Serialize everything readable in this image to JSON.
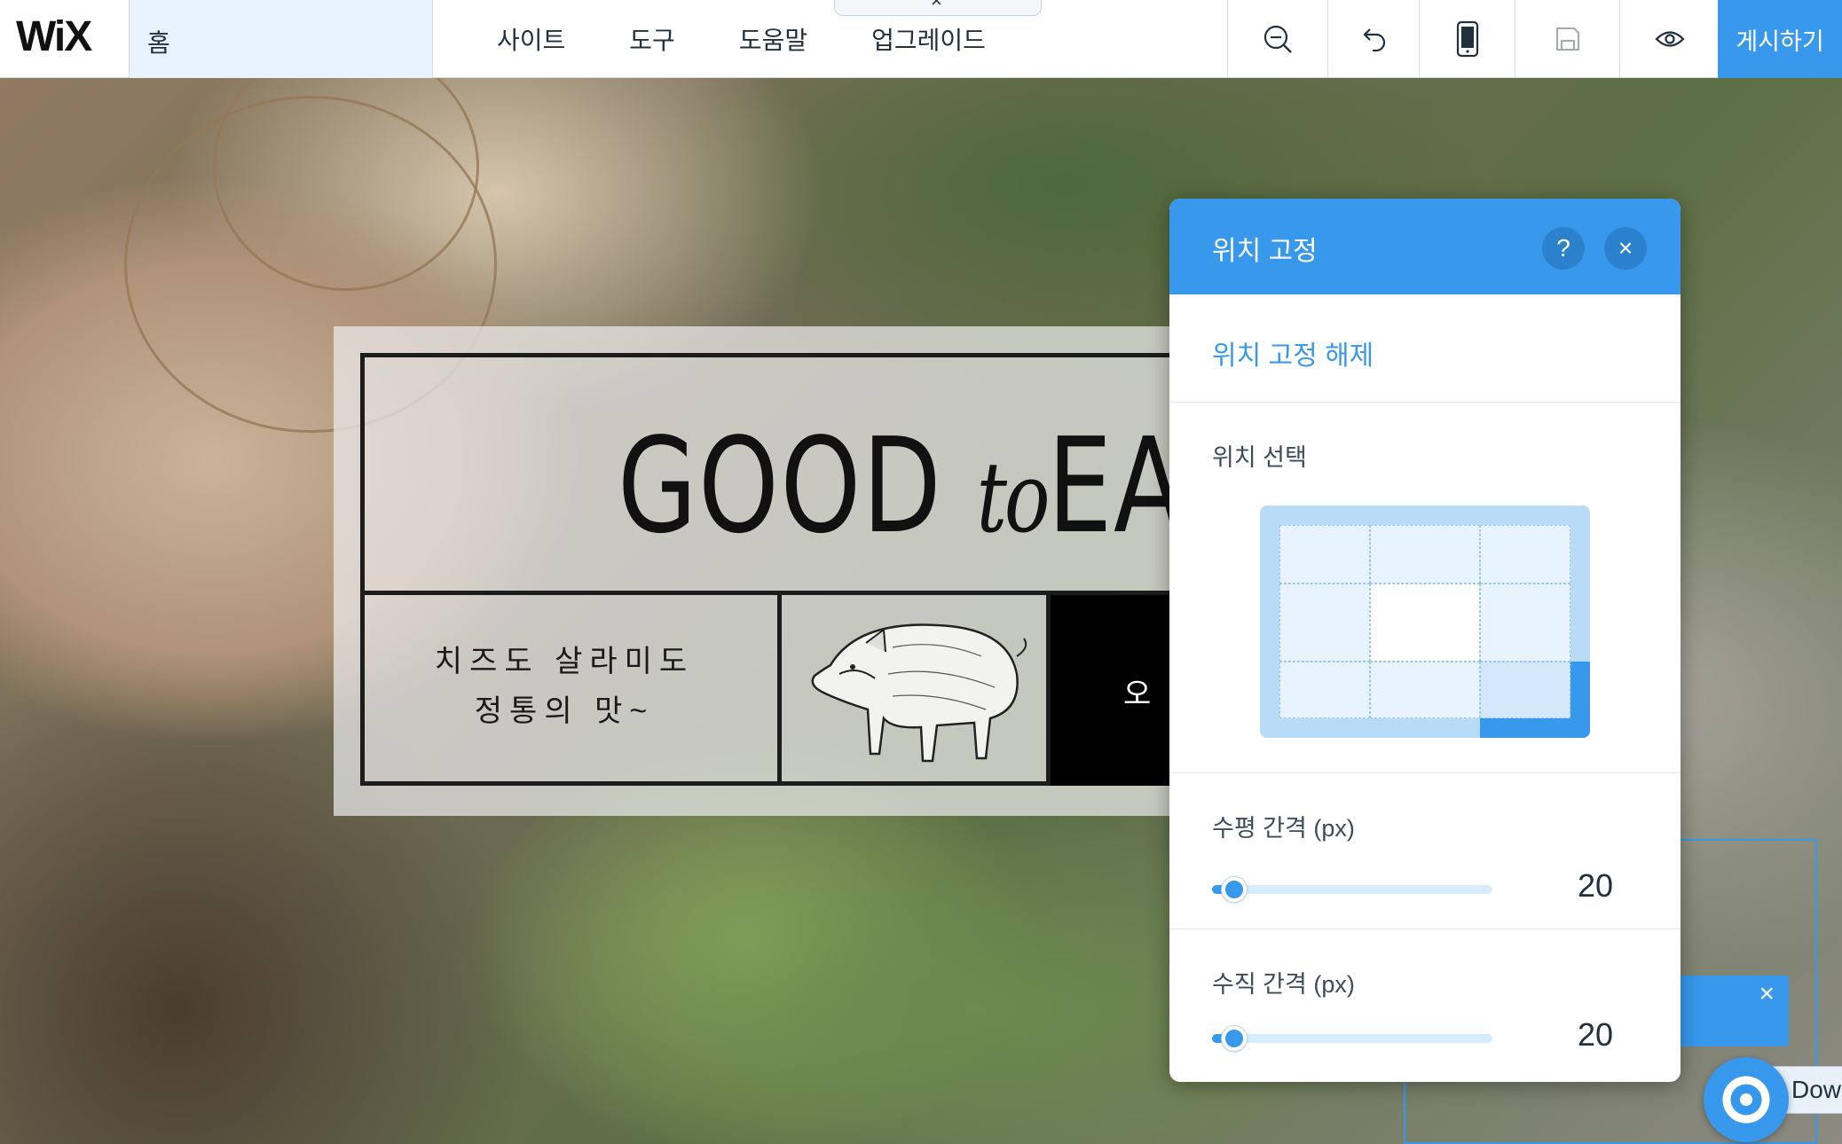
{
  "app": {
    "logo": "WiX",
    "page": "홈"
  },
  "menu": [
    "사이트",
    "도구",
    "도움말",
    "업그레이드"
  ],
  "tab_close": "×",
  "toolbar": {
    "zoom": "zoom-out-icon",
    "undo": "undo-icon",
    "mobile": "mobile-icon",
    "save": "save-icon",
    "preview": "eye-icon",
    "publish_label": "게시하기"
  },
  "site": {
    "headline_part1": "GOOD",
    "headline_part2": "to",
    "headline_part3": "EA",
    "blurb_line1": "치즈도 살라미도",
    "blurb_line2": "정통의 맛~",
    "black_block_text": "오"
  },
  "panel": {
    "title": "위치 고정",
    "help": "?",
    "close": "×",
    "unpin": "위치 고정 해제",
    "position_label": "위치 선택",
    "selected_position": "bottom-right",
    "horizontal_label": "수평 간격 (px)",
    "horizontal_value": "20",
    "vertical_label": "수직 간격 (px)",
    "vertical_value": "20",
    "horizontal_fraction": 0.08,
    "vertical_fraction": 0.08
  },
  "overlay": {
    "strip_close": "×",
    "fab_label": "Dow"
  },
  "colors": {
    "accent": "#3899ec",
    "panel_bg": "#ffffff",
    "text": "#20303c"
  }
}
